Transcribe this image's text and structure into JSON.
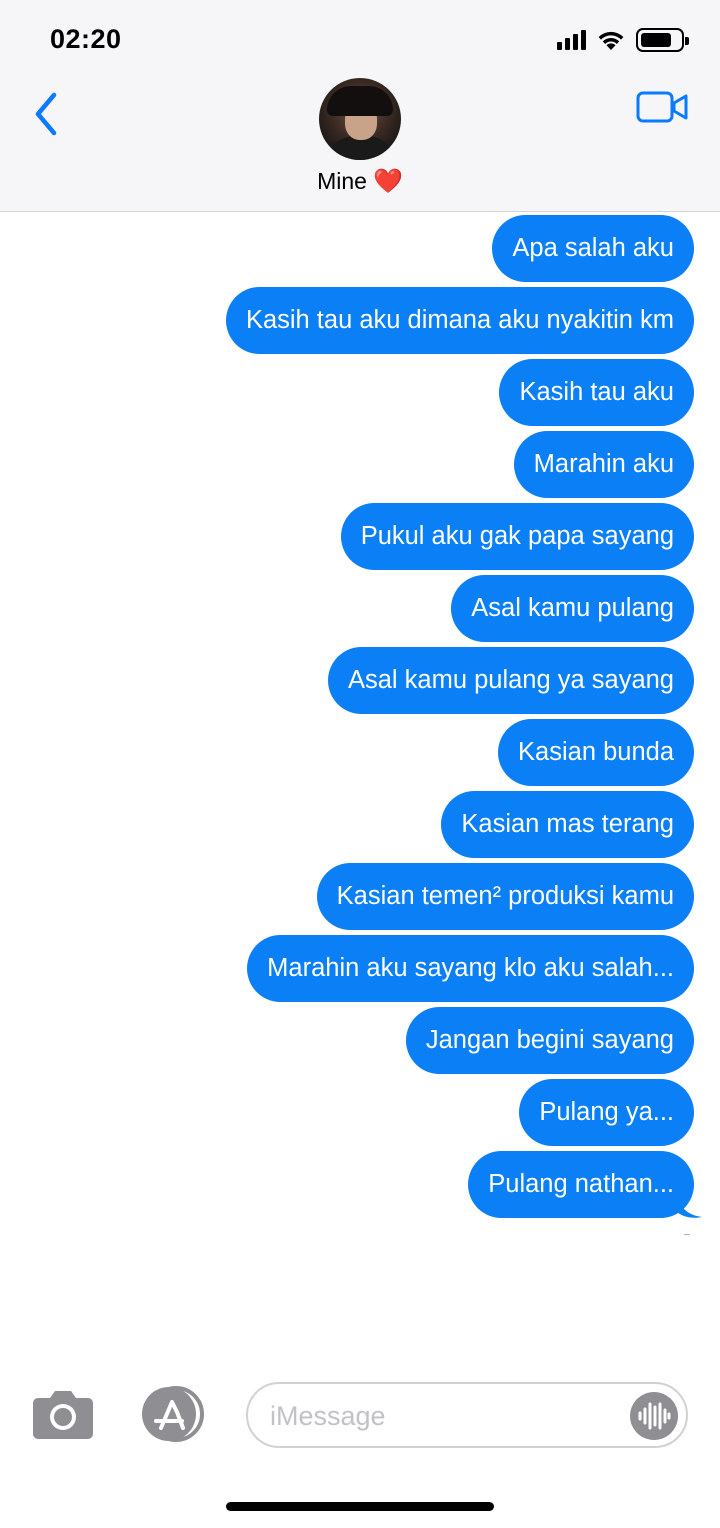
{
  "status_bar": {
    "time": "02:20",
    "icons": [
      "cellular-signal-icon",
      "wifi-icon",
      "battery-icon"
    ],
    "battery_level": 0.8
  },
  "header": {
    "back_icon": "chevron-left-icon",
    "video_icon": "video-camera-icon",
    "contact_name": "Mine",
    "contact_emoji": "❤️"
  },
  "messages": [
    {
      "text": "Apa salah aku"
    },
    {
      "text": "Kasih tau aku dimana aku nyakitin km"
    },
    {
      "text": "Kasih tau aku"
    },
    {
      "text": "Marahin aku"
    },
    {
      "text": "Pukul aku gak papa sayang"
    },
    {
      "text": "Asal kamu pulang"
    },
    {
      "text": "Asal kamu pulang ya sayang"
    },
    {
      "text": "Kasian bunda"
    },
    {
      "text": "Kasian mas terang"
    },
    {
      "text": "Kasian temen² produksi kamu"
    },
    {
      "text": "Marahin aku sayang klo aku salah..."
    },
    {
      "text": "Jangan begini sayang"
    },
    {
      "text": "Pulang ya..."
    },
    {
      "text": "Pulang nathan..."
    }
  ],
  "composer": {
    "placeholder": "iMessage",
    "camera_icon": "camera-icon",
    "apps_icon": "app-store-icon",
    "audio_icon": "audio-waveform-icon"
  },
  "colors": {
    "bubble": "#0b7ff5",
    "accent": "#0a7aff",
    "header_bg": "#f6f6f8"
  }
}
